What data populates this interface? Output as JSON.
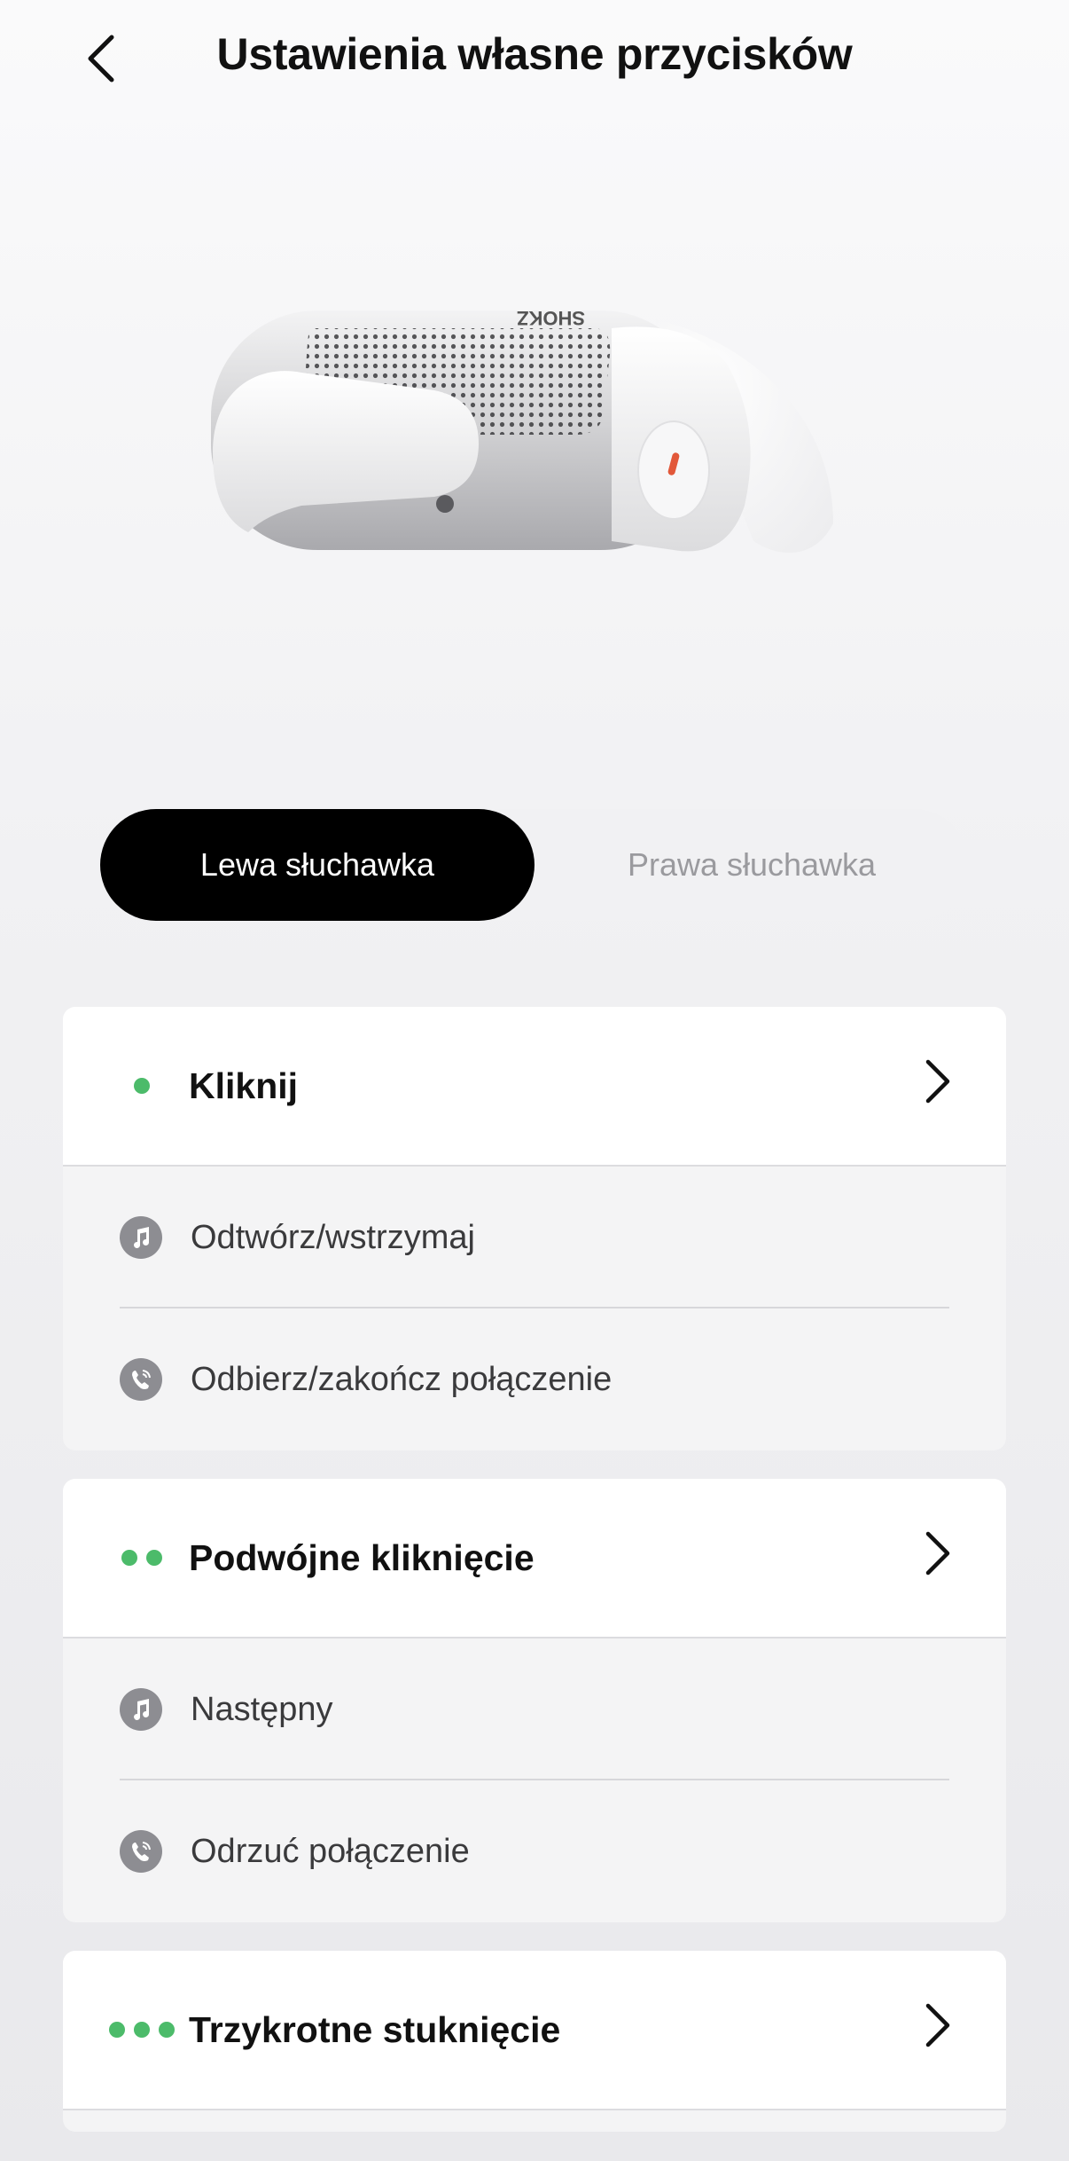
{
  "header": {
    "title": "Ustawienia własne przycisków",
    "back_icon": "chevron-left-icon"
  },
  "product": {
    "brand_mark": "SHOKZ"
  },
  "tabs": [
    {
      "label": "Lewa słuchawka",
      "selected": true
    },
    {
      "label": "Prawa słuchawka",
      "selected": false
    }
  ],
  "colors": {
    "accent_dot": "#4cbb6a",
    "selected_tab": "#000000"
  },
  "gestures": [
    {
      "title": "Kliknij",
      "dot_count": 1,
      "actions": [
        {
          "icon": "music-note-icon",
          "label": "Odtwórz/wstrzymaj"
        },
        {
          "icon": "phone-call-icon",
          "label": "Odbierz/zakończ połączenie"
        }
      ]
    },
    {
      "title": "Podwójne kliknięcie",
      "dot_count": 2,
      "actions": [
        {
          "icon": "music-note-icon",
          "label": "Następny"
        },
        {
          "icon": "phone-call-icon",
          "label": "Odrzuć połączenie"
        }
      ]
    },
    {
      "title": "Trzykrotne stuknięcie",
      "dot_count": 3,
      "actions": []
    }
  ]
}
